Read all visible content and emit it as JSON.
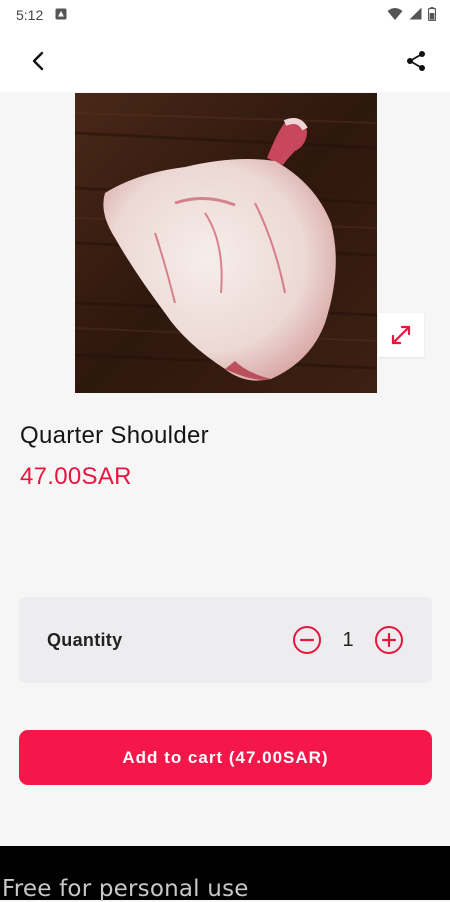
{
  "status_bar": {
    "time": "5:12"
  },
  "app_bar": {
    "back_icon": "arrow-back-icon",
    "share_icon": "share-icon"
  },
  "product": {
    "title": "Quarter Shoulder",
    "price": "47.00SAR",
    "image_description": "raw-lamb-shoulder-on-wooden-board"
  },
  "quantity": {
    "label": "Quantity",
    "value": "1",
    "decrement_icon": "minus-circle-icon",
    "increment_icon": "plus-circle-icon"
  },
  "cart": {
    "button_label": "Add to cart (47.00SAR)"
  },
  "watermark": {
    "text": "Free for personal use"
  },
  "colors": {
    "accent": "#e8163f",
    "button": "#f5174a",
    "background": "#f6f6f7",
    "card": "#ededf0"
  }
}
